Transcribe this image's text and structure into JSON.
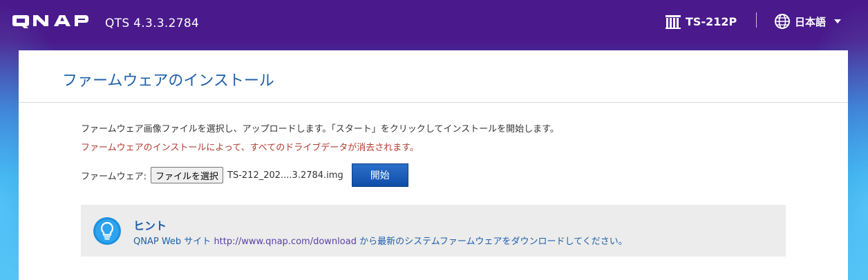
{
  "header": {
    "logo_text": "QNAP",
    "version": "QTS 4.3.3.2784",
    "model": "TS-212P",
    "language": "日本語"
  },
  "panel": {
    "title": "ファームウェアのインストール",
    "description": "ファームウェア画像ファイルを選択し、アップロードします。「スタート」をクリックしてインストールを開始します。",
    "warning": "ファームウェアのインストールによって、すべてのドライブデータが消去されます。",
    "firmware_label": "ファームウェア:",
    "choose_file_label": "ファイルを選択",
    "file_name": "TS-212_202....3.2784.img",
    "start_label": "開始"
  },
  "hint": {
    "title": "ヒント",
    "text_prefix": "QNAP Web サイト ",
    "link": "http://www.qnap.com/download",
    "text_suffix": " から最新のシステムファームウェアをダウンロードしてください。"
  },
  "colors": {
    "header_top": "#4a1a8c",
    "title_blue": "#1d5fa8",
    "warning_red": "#b23a2e",
    "button_blue": "#0d4fa8"
  },
  "icons": {
    "model": "nas-server-icon",
    "language": "globe-icon",
    "dropdown": "chevron-down-icon",
    "hint": "lightbulb-icon"
  }
}
